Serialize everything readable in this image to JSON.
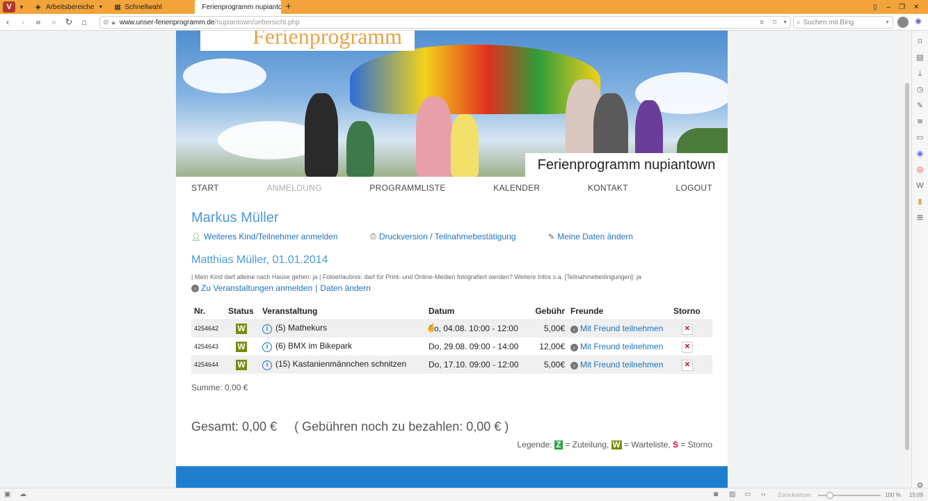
{
  "browser": {
    "tabs": [
      {
        "label": "Arbeitsbereiche"
      },
      {
        "label": "Schnellwahl"
      },
      {
        "label": "Ferienprogramm nupiantc"
      }
    ],
    "url_host": "www.unser-ferienprogramm.de",
    "url_path": "/nupiantown/uebersicht.php",
    "search_placeholder": "Suchen mit Bing",
    "zoom": "100 %",
    "reset_label": "Zurücksetzen",
    "time": "15:09"
  },
  "header": {
    "logo_text": "Ferienprogramm",
    "site_title": "Ferienprogramm nupiantown"
  },
  "nav": [
    "START",
    "ANMELDUNG",
    "PROGRAMMLISTE",
    "KALENDER",
    "KONTAKT",
    "LOGOUT"
  ],
  "user": {
    "name": "Markus Müller",
    "action_add": "Weiteres Kind/Teilnehmer anmelden",
    "action_print": "Druckversion / Teilnahmebestätigung",
    "action_edit": "Meine Daten ändern"
  },
  "child": {
    "name": "Matthias Müller, 01.01.2014",
    "info": "| Mein Kind darf alleine nach Hause gehen: ja | Fotoerlaubnis: darf für Print- und Online-Medien fotografiert werden? Weitere Infos s.a. [Teilnahmebedingungen]: ja",
    "link_register": "Zu Veranstaltungen anmelden",
    "link_sep": "|",
    "link_edit": "Daten ändern"
  },
  "table": {
    "headers": [
      "Nr.",
      "Status",
      "Veranstaltung",
      "Datum",
      "Gebühr",
      "Freunde",
      "Storno"
    ],
    "rows": [
      {
        "nr": "4254642",
        "status": "W",
        "event": "(5) Mathekurs",
        "date": "So, 04.08. 10:00 - 12:00",
        "fee": "5,00€",
        "friends": "Mit Freund teilnehmen"
      },
      {
        "nr": "4254643",
        "status": "W",
        "event": "(6) BMX im Bikepark",
        "date": "Do, 29.08. 09:00 - 14:00",
        "fee": "12,00€",
        "friends": "Mit Freund teilnehmen"
      },
      {
        "nr": "4254644",
        "status": "W",
        "event": "(15) Kastanienmännchen schnitzen",
        "date": "Do, 17.10. 09:00 - 12:00",
        "fee": "5,00€",
        "friends": "Mit Freund teilnehmen"
      }
    ]
  },
  "summary": {
    "sum": "Summe: 0,00 €",
    "total": "Gesamt: 0,00 €",
    "outstanding": "( Gebühren noch zu bezahlen: 0,00 € )"
  },
  "legend": {
    "prefix": "Legende:",
    "z_letter": "Z",
    "z_text": "= Zuteilung,",
    "w_letter": "W",
    "w_text": "= Warteliste,",
    "s_letter": "S",
    "s_text": "= Storno"
  },
  "colors": {
    "accent": "#1e73be",
    "heading": "#4b9bd6",
    "status_w": "#7a8a0e",
    "status_z": "#2ea043",
    "storno": "#d0021b",
    "tabbar": "#f2a43a"
  }
}
